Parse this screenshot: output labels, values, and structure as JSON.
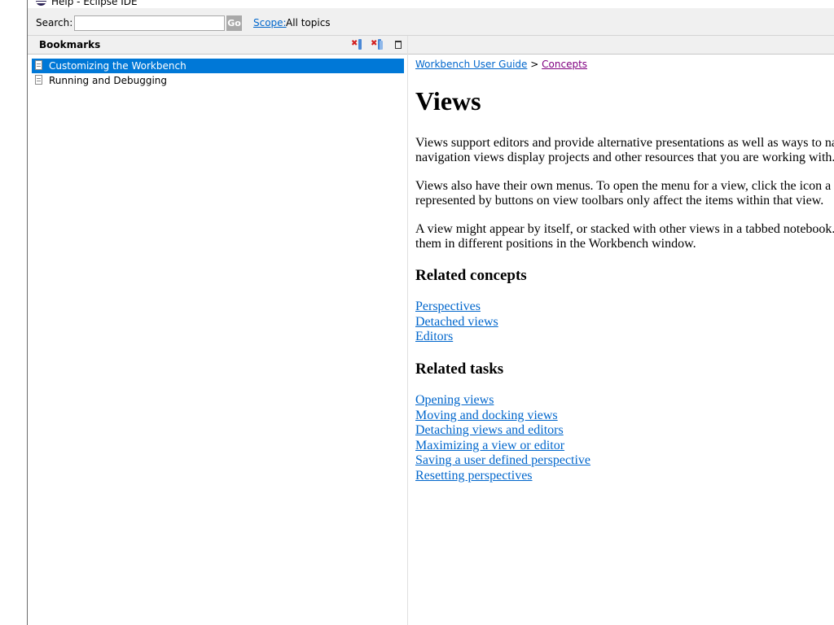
{
  "window": {
    "title": "Help - Eclipse IDE"
  },
  "search": {
    "label": "Search:",
    "value": "",
    "placeholder": "",
    "go_label": "Go",
    "scope_link": "Scope:",
    "scope_value": "All topics"
  },
  "bookmarks": {
    "title": "Bookmarks",
    "items": [
      {
        "label": "Customizing the Workbench",
        "selected": true
      },
      {
        "label": "Running and Debugging",
        "selected": false
      }
    ]
  },
  "content": {
    "breadcrumb": [
      "Workbench User Guide",
      "Concepts"
    ],
    "breadcrumb_separator": ">",
    "title": "Views",
    "paragraphs": [
      [
        "Views support editors and provide alternative presentations as well as ways to na",
        "navigation views display projects and other resources that you are working with."
      ],
      [
        "Views also have their own menus. To open the menu for a view, click the icon a",
        "represented by buttons on view toolbars only affect the items within that view."
      ],
      [
        "A view might appear by itself, or stacked with other views in a tabbed notebook.",
        "them in different positions in the Workbench window."
      ]
    ],
    "related_concepts": {
      "heading": "Related concepts",
      "links": [
        "Perspectives",
        "Detached views",
        "Editors"
      ]
    },
    "related_tasks": {
      "heading": "Related tasks",
      "links": [
        "Opening views",
        "Moving and docking views",
        "Detaching views and editors",
        "Maximizing a view or editor",
        "Saving a user defined perspective",
        "Resetting perspectives"
      ]
    }
  },
  "colors": {
    "selection": "#0078d7",
    "link": "#0066cc",
    "visited_link": "#800080",
    "toolbar_bg": "#f0f0f0"
  }
}
